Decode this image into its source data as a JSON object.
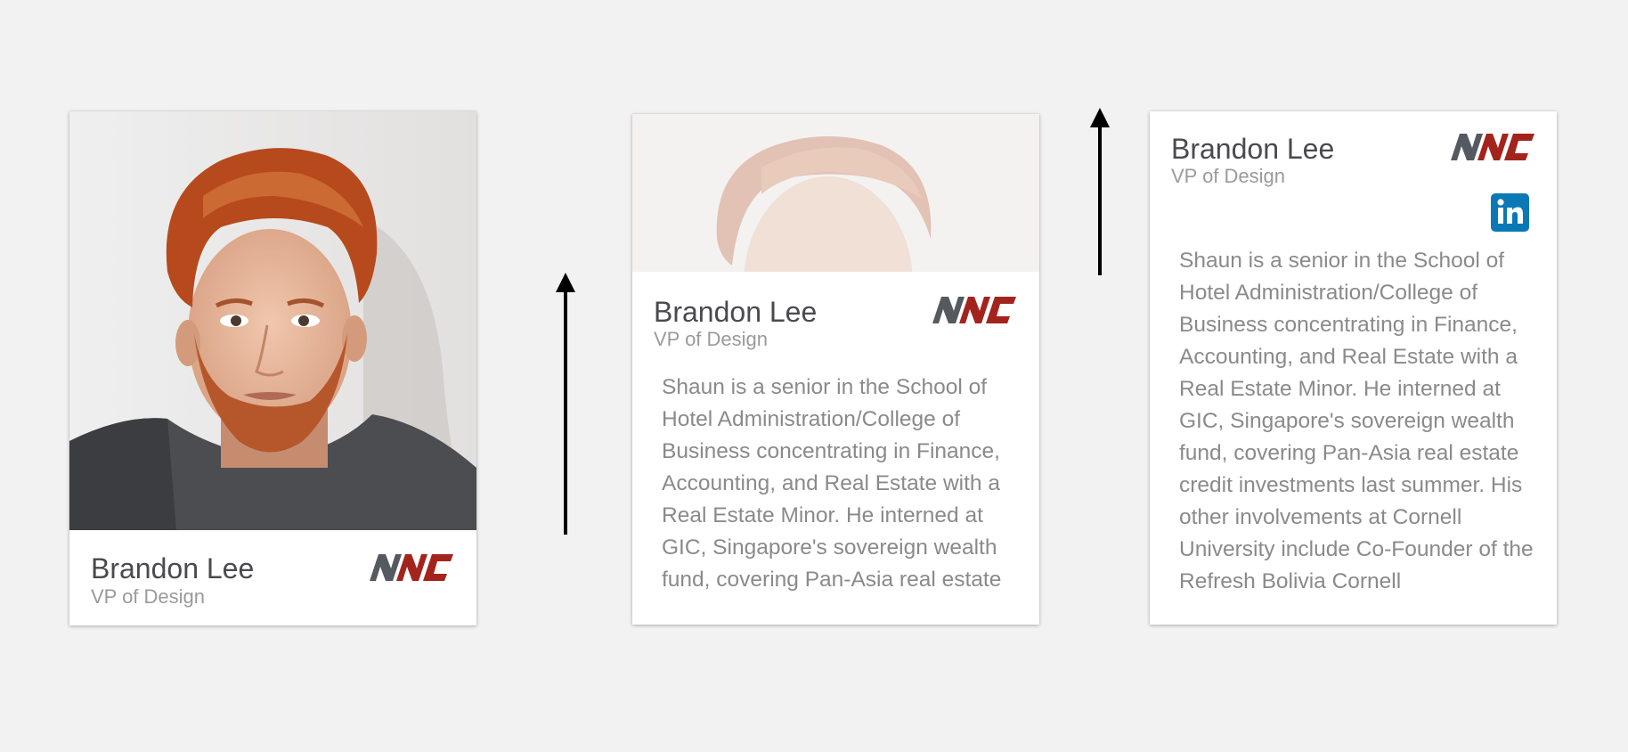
{
  "cards": [
    {
      "name": "Brandon Lee",
      "title": "VP of Design",
      "logo": "NCC",
      "photo": "portrait"
    },
    {
      "name": "Brandon Lee",
      "title": "VP of Design",
      "logo": "NCC",
      "photo": "faded-portrait",
      "bio": "Shaun is a senior in the School of Hotel Administration/College of Business concentrating in Finance, Accounting, and Real Estate with a Real Estate Minor. He interned at GIC, Singapore's sovereign wealth fund, covering Pan-Asia real estate"
    },
    {
      "name": "Brandon Lee",
      "title": "VP of Design",
      "logo": "NCC",
      "social_icon": "linkedin-icon",
      "bio": "Shaun is a senior in the School of Hotel Administration/College of Business concentrating in Finance, Accounting, and Real Estate with a Real Estate Minor. He interned at GIC, Singapore's sovereign wealth fund, covering Pan-Asia real estate credit investments last summer. His other involvements at Cornell University include Co-Founder of the Refresh Bolivia Cornell"
    }
  ],
  "arrows": [
    "up-arrow-icon",
    "up-arrow-icon"
  ],
  "colors": {
    "background": "#f2f2f2",
    "card": "#ffffff",
    "name_text": "#4a4a4e",
    "secondary_text": "#9a9a9a",
    "logo_gray": "#555a60",
    "logo_red": "#a3241c",
    "linkedin": "#0a78b5"
  }
}
